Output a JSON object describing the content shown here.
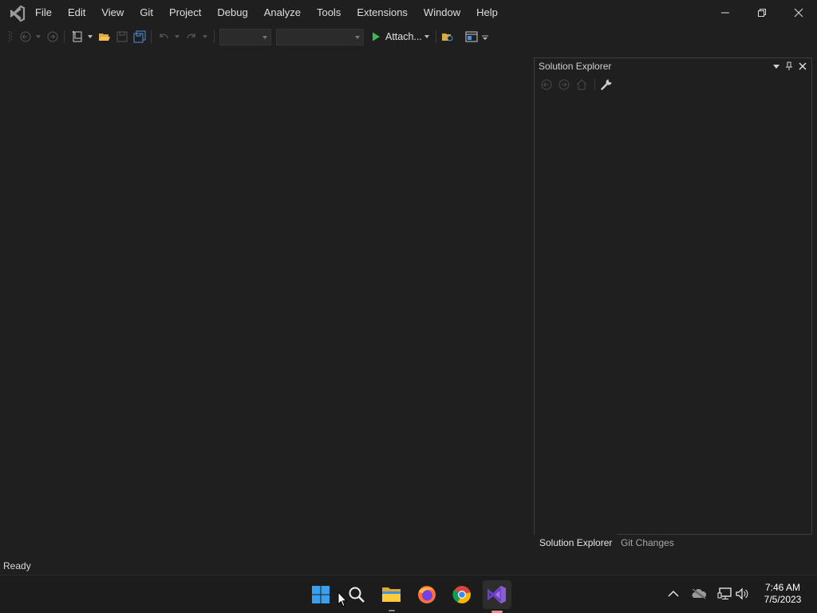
{
  "menu": [
    "File",
    "Edit",
    "View",
    "Git",
    "Project",
    "Debug",
    "Analyze",
    "Tools",
    "Extensions",
    "Window",
    "Help"
  ],
  "toolbar": {
    "attach_label": "Attach...",
    "config_value": "",
    "platform_value": "",
    "icons": [
      "back-icon",
      "forward-icon",
      "new-project-icon",
      "open-folder-icon",
      "save-icon",
      "save-all-icon",
      "undo-icon",
      "redo-icon",
      "start-icon",
      "browse-folder-icon",
      "window-layout-icon"
    ]
  },
  "solution_explorer": {
    "title": "Solution Explorer",
    "tabs": [
      "Solution Explorer",
      "Git Changes"
    ]
  },
  "status": {
    "text": "Ready"
  },
  "taskbar": {
    "apps": [
      "start-icon",
      "search-icon",
      "file-explorer-icon",
      "firefox-icon",
      "chrome-icon",
      "visual-studio-icon"
    ],
    "clock": {
      "time": "7:46 AM",
      "date": "7/5/2023"
    }
  },
  "colors": {
    "accent": "#68217a",
    "background": "#1f1f1f",
    "start_green": "#3fb950"
  }
}
